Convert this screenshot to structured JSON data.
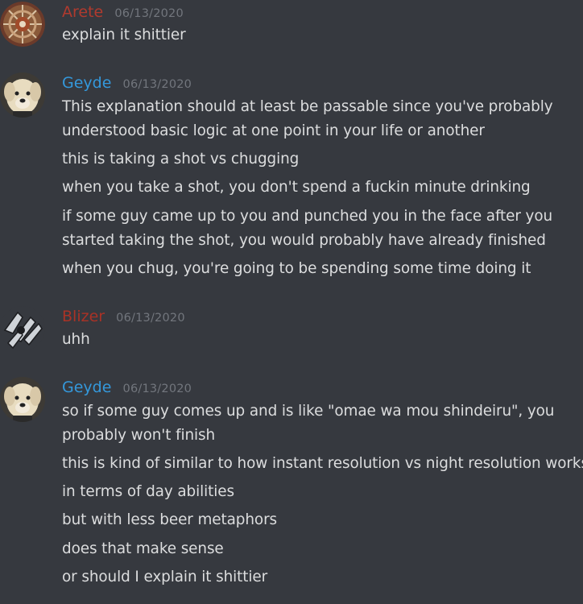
{
  "colors": {
    "background": "#36393f",
    "text": "#dcddde",
    "timestamp": "#72767d",
    "arete_name": "#b03a2e",
    "geyde_name": "#3498db",
    "blizer_name": "#a93226"
  },
  "messages": [
    {
      "author": "Arete",
      "timestamp": "06/13/2020",
      "avatar_icon": "mandala-avatar-icon",
      "lines": [
        "explain it shittier"
      ]
    },
    {
      "author": "Geyde",
      "timestamp": "06/13/2020",
      "avatar_icon": "dog-avatar-icon",
      "lines": [
        "This explanation should at least be passable since you've probably",
        "understood basic logic at one point in your life or another",
        "this is taking a shot vs chugging",
        "when you take a shot, you don't spend a fuckin minute drinking",
        "if some guy came up to you and punched you in the face after you",
        "started taking the shot, you would probably have already finished",
        "when you chug, you're going to be spending some time doing it"
      ]
    },
    {
      "author": "Blizer",
      "timestamp": "06/13/2020",
      "avatar_icon": "mech-avatar-icon",
      "lines": [
        "uhh"
      ]
    },
    {
      "author": "Geyde",
      "timestamp": "06/13/2020",
      "avatar_icon": "dog-avatar-icon",
      "lines": [
        "so if some guy comes up and is like \"omae wa mou shindeiru\", you",
        "probably won't finish",
        "this is kind of similar to how instant resolution vs night resolution works",
        "in terms of day abilities",
        "but with less beer metaphors",
        "does that make sense",
        "or should I explain it shittier"
      ]
    }
  ]
}
